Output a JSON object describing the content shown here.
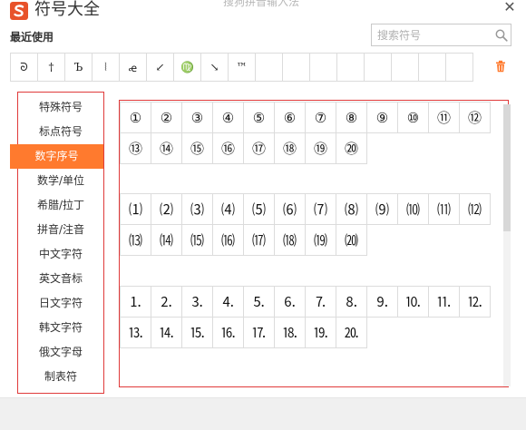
{
  "window": {
    "title": "符号大全",
    "subtitle": "搜狗拼音输入法",
    "close_glyph": "✕"
  },
  "recent": {
    "label": "最近使用",
    "items": [
      "ᘐ",
      "†",
      "Ъ",
      "⦚",
      "ꬴ",
      "↙",
      "♍",
      "↘",
      "™",
      "",
      "",
      "",
      "",
      "",
      "",
      "",
      ""
    ]
  },
  "search": {
    "placeholder": "搜索符号"
  },
  "sidebar": {
    "items": [
      {
        "label": "特殊符号",
        "active": false
      },
      {
        "label": "标点符号",
        "active": false
      },
      {
        "label": "数字序号",
        "active": true
      },
      {
        "label": "数学/单位",
        "active": false
      },
      {
        "label": "希腊/拉丁",
        "active": false
      },
      {
        "label": "拼音/注音",
        "active": false
      },
      {
        "label": "中文字符",
        "active": false
      },
      {
        "label": "英文音标",
        "active": false
      },
      {
        "label": "日文字符",
        "active": false
      },
      {
        "label": "韩文字符",
        "active": false
      },
      {
        "label": "俄文字母",
        "active": false
      },
      {
        "label": "制表符",
        "active": false
      }
    ]
  },
  "symbol_groups": [
    [
      "①",
      "②",
      "③",
      "④",
      "⑤",
      "⑥",
      "⑦",
      "⑧",
      "⑨",
      "⑩",
      "⑪",
      "⑫",
      "⑬",
      "⑭",
      "⑮",
      "⑯",
      "⑰",
      "⑱",
      "⑲",
      "⑳"
    ],
    [
      "⑴",
      "⑵",
      "⑶",
      "⑷",
      "⑸",
      "⑹",
      "⑺",
      "⑻",
      "⑼",
      "⑽",
      "⑾",
      "⑿",
      "⒀",
      "⒁",
      "⒂",
      "⒃",
      "⒄",
      "⒅",
      "⒆",
      "⒇"
    ],
    [
      "⒈",
      "⒉",
      "⒊",
      "⒋",
      "⒌",
      "⒍",
      "⒎",
      "⒏",
      "⒐",
      "⒑",
      "⒒",
      "⒓",
      "⒔",
      "⒕",
      "⒖",
      "⒗",
      "⒘",
      "⒙",
      "⒚",
      "⒛"
    ]
  ],
  "colors": {
    "accent": "#ff7a2e",
    "highlight_border": "#e03a3a",
    "logo": "#e8522a"
  },
  "icons": {
    "logo": "sogou-s-icon",
    "search": "search-icon",
    "trash": "trash-icon",
    "close": "close-icon"
  }
}
